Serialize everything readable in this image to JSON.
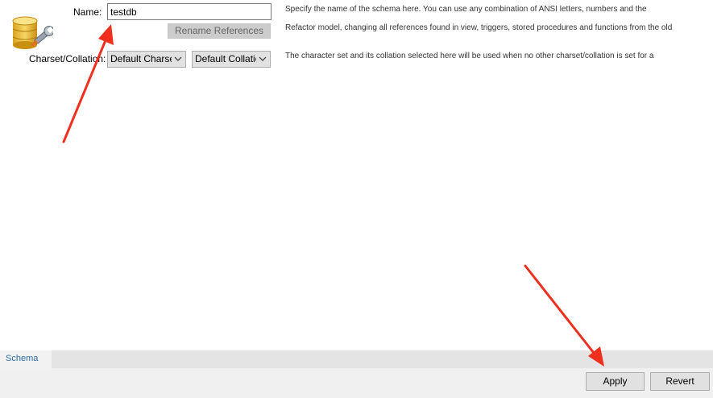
{
  "form": {
    "name_label": "Name:",
    "name_value": "testdb",
    "rename_button": "Rename References",
    "charset_label": "Charset/Collation:",
    "charset_value": "Default Charset",
    "collation_value": "Default Collation",
    "help_name_line1": "Specify the name of the schema here. You can use any combination of ANSI letters, numbers and the",
    "help_name_line2": "Refactor model, changing all references found in view, triggers, stored procedures and functions from the old",
    "help_charset": "The character set and its collation selected here will be used when no other charset/collation is set for a"
  },
  "tabs": [
    "Schema"
  ],
  "footer": {
    "apply_label": "Apply",
    "revert_label": "Revert"
  },
  "colors": {
    "accent_tab": "#2b6ca3",
    "annotation_arrow": "#f02f1e"
  },
  "icons": {
    "schema": "database-wrench-icon",
    "dropdown": "chevron-down-icon"
  }
}
